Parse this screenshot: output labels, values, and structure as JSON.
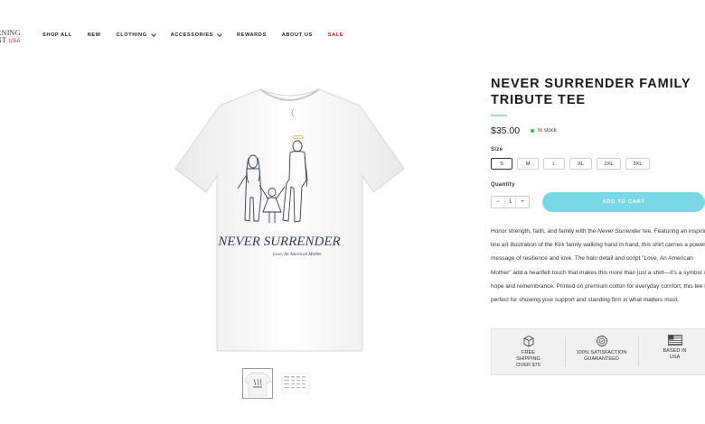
{
  "brand": {
    "line1": "RNING",
    "line2": "NT",
    "usa": "USA"
  },
  "nav": [
    {
      "label": "SHOP ALL",
      "dropdown": false
    },
    {
      "label": "NEW",
      "dropdown": false
    },
    {
      "label": "CLOTHING",
      "dropdown": true
    },
    {
      "label": "ACCESSORIES",
      "dropdown": true
    },
    {
      "label": "REWARDS",
      "dropdown": false
    },
    {
      "label": "ABOUT US",
      "dropdown": false
    },
    {
      "label": "SALE",
      "dropdown": false
    }
  ],
  "product": {
    "title": "NEVER SURRENDER FAMILY TRIBUTE TEE",
    "price": "$35.00",
    "stock": "In stock",
    "size_label": "Size",
    "sizes": [
      "S",
      "M",
      "L",
      "XL",
      "2XL",
      "3XL"
    ],
    "selected_size": "S",
    "quantity_label": "Quantity",
    "quantity": "1",
    "qty_minus": "−",
    "qty_plus": "+",
    "add_to_cart": "ADD TO CART",
    "shirt_print_title": "NEVER SURRENDER",
    "shirt_print_sub": "Love, An American Mother",
    "desc_pre": "Honor strength, faith, and family with the ",
    "desc_em": "Never Surrender",
    "desc_post": " tee. Featuring an inspiring line art illustration of the Kirk family walking hand in hand, this shirt carries a powerful message of resilience and love. The halo detail and script \"Love, An American Mother\" add a heartfelt touch that makes this more than just a shirt—it's a symbol of hope and remembrance. Printed on premium cotton for everyday comfort, this tee is perfect for showing your support and standing firm in what matters most."
  },
  "badges": [
    {
      "icon": "box-icon",
      "text": "FREE SHIPPING OVER $75"
    },
    {
      "icon": "satisfaction-seal-icon",
      "text": "100% SATISFACTION GUARANTEED"
    },
    {
      "icon": "usa-flag-icon",
      "text": "BASED IN USA"
    }
  ],
  "colors": {
    "accent": "#7ad8e6",
    "sale": "#d0202c",
    "in_stock": "#35b44a",
    "brand_navy": "#1d2b4f"
  }
}
